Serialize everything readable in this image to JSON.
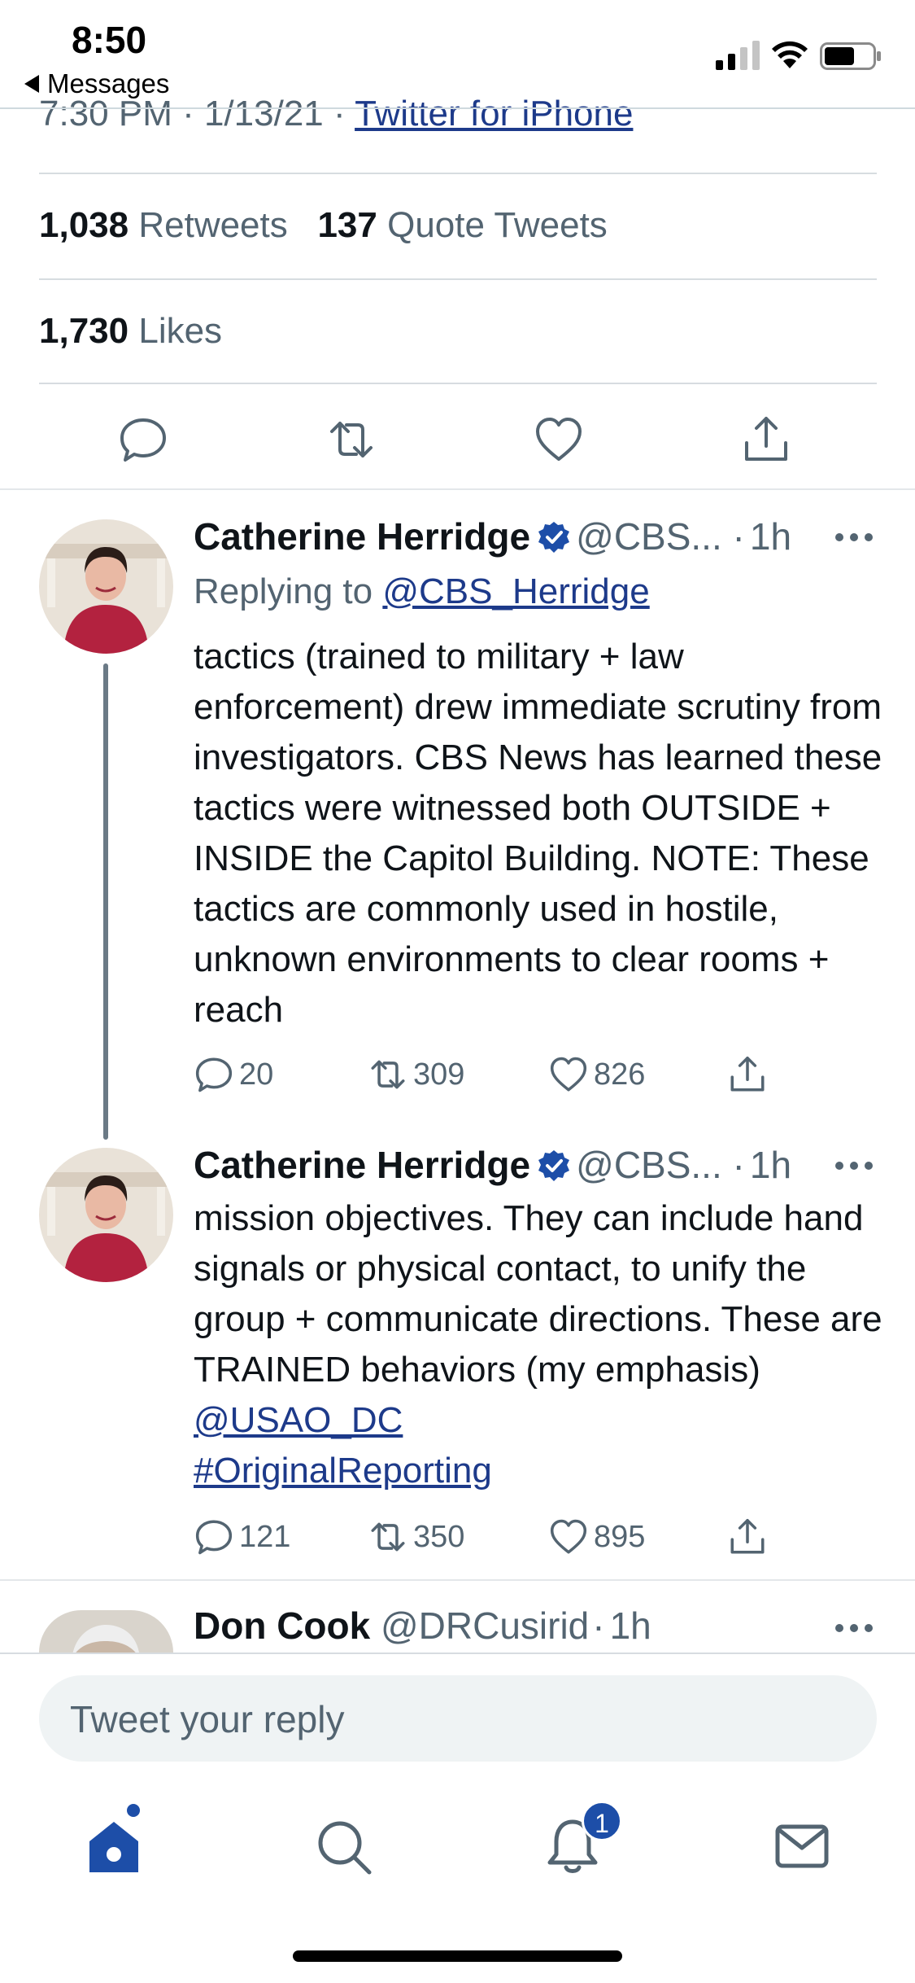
{
  "status_bar": {
    "time": "8:50",
    "back_app": "Messages",
    "icons": [
      "cellular-signal-icon",
      "wifi-icon",
      "battery-icon"
    ]
  },
  "tweet_detail": {
    "time_date": "7:30 PM · 1/13/21 · ",
    "source": "Twitter for iPhone",
    "retweets_count": "1,038",
    "retweets_label": "Retweets",
    "quotes_count": "137",
    "quotes_label": "Quote Tweets",
    "likes_count": "1,730",
    "likes_label": "Likes",
    "actions": [
      "reply-icon",
      "retweet-icon",
      "like-icon",
      "share-icon"
    ]
  },
  "replies": [
    {
      "name": "Catherine Herridge",
      "handle": "@CBS... ",
      "dot": "·",
      "time": "1h",
      "replying_label": "Replying to ",
      "replying_handle": "@CBS_Herridge",
      "text": "tactics (trained to military + law enforcement) drew immediate scrutiny from investigators. CBS News has learned these tactics were witnessed both OUTSIDE + INSIDE the Capitol Building. NOTE: These tactics are commonly used in hostile, unknown environments to clear rooms + reach",
      "reply_count": "20",
      "retweet_count": "309",
      "like_count": "826"
    },
    {
      "name": "Catherine Herridge",
      "handle": "@CBS... ",
      "dot": "·",
      "time": "1h",
      "text": "mission objectives. They can include hand signals or physical contact, to unify the group + communicate directions. These are TRAINED behaviors (my emphasis) ",
      "mention": "@USAO_DC",
      "hashtag": "#OriginalReporting",
      "reply_count": "121",
      "retweet_count": "350",
      "like_count": "895"
    },
    {
      "name": "Don Cook",
      "handle": "@DRCusirid",
      "dot": "·",
      "time": "1h"
    }
  ],
  "composer": {
    "placeholder": "Tweet your reply"
  },
  "tab_bar": {
    "tabs": [
      "home-icon",
      "search-icon",
      "notifications-icon",
      "messages-icon"
    ],
    "notification_badge": "1"
  },
  "colors": {
    "link": "#1d3a8a",
    "verified": "#1d4ea8",
    "secondary_text": "#536471"
  }
}
